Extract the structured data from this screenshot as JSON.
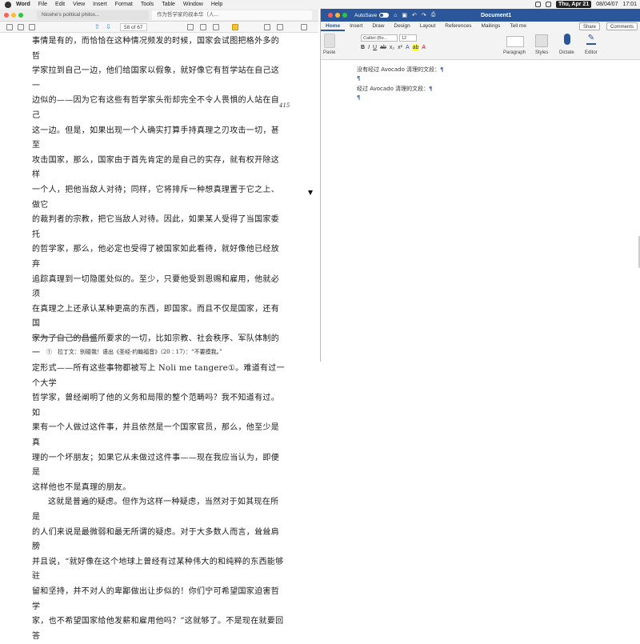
{
  "menubar": {
    "items": [
      "Word",
      "File",
      "Edit",
      "View",
      "Insert",
      "Format",
      "Tools",
      "Table",
      "Window",
      "Help"
    ],
    "date_badge": "Thu, Apr 21",
    "date": "08/04/07",
    "time": "17:01"
  },
  "pdf": {
    "tabs": [
      "Nicehe's political philos...",
      "作为哲学家的叔本华（人..."
    ],
    "page_indicator": "58 of 67",
    "lines": [
      "事情是有的，而恰恰在这种情况频发的时候，国家会试图把格外多的哲",
      "学家拉到自己一边，他们给国家以假象，就好像它有哲学站在自己这一",
      "边似的——因为它有这些有哲学家头衔却完全不令人畏惧的人站在自己",
      "这一边。但是，如果出现一个人确实打算手持真理之刃攻击一切，甚至",
      "攻击国家，那么，国家由于首先肯定的是自己的实存，就有权开除这样",
      "一个人，把他当敌人对待；同样，它将排斥一种想真理置于它之上、做它",
      "的裁判者的宗教，把它当敌人对待。因此，如果某人受得了当国家委托",
      "的哲学家，那么，他必定也受得了被国家如此看待，就好像他已经放弃",
      "追踪真理到一切隐匿处似的。至少，只要他受到恩赐和雇用，他就必须",
      "在真理之上还承认某种更高的东西，即国家。而且不仅是国家，还有国",
      "家为了自己的昌盛所要求的一切，比如宗教、社会秩序、军队体制的一",
      "定形式——所有这些事物都被写上 Noli me tangere①。难道有过一个大学",
      "哲学家，曾经阐明了他的义务和局限的整个范畴吗？我不知道有过。如",
      "果有一个人做过这件事，并且依然是一个国家官员，那么，他至少是真",
      "理的一个坏朋友；如果它从未做过这件事——现在我应当认为，即便是",
      "这样他也不是真理的朋友。",
      "这就是普遍的疑虑。但作为这样一种疑虑，当然对于如其现在所是",
      "的人们来说是最微弱和最无所谓的疑虑。对于大多数人而言，耸耸肩膀",
      "并且说，“就好像在这个地球上曾经有过某种伟大的和纯粹的东西能够驻",
      "留和坚持，并不对人的卑鄙做出让步似的！你们宁可希望国家迫害哲学",
      "家，也不希望国家给他发薪和雇用他吗？”这就够了。不是现在就要回答"
    ],
    "margin_number": "415",
    "footnote": "①　拉丁文：别碰我！语出《圣经·约翰福音》（20∶17）：“不要摸我。”"
  },
  "word": {
    "autosave": "AutoSave",
    "doc_title": "Document1",
    "tabs": [
      "Home",
      "Insert",
      "Draw",
      "Design",
      "Layout",
      "References",
      "Mailings",
      "Tell me"
    ],
    "share": "Share",
    "comments": "Comments",
    "ribbon": {
      "paste": "Paste",
      "font": "Calibri (Bo...",
      "size": "12",
      "paragraph": "Paragraph",
      "styles": "Styles",
      "dictate": "Dictate",
      "editor": "Editor"
    },
    "lines": [
      "没有经过 Avocado 清理的文段：",
      "经过 Avocado 清理的文段："
    ],
    "pilcrow": "¶"
  },
  "colors": {
    "word_blue": "#2b579a"
  }
}
